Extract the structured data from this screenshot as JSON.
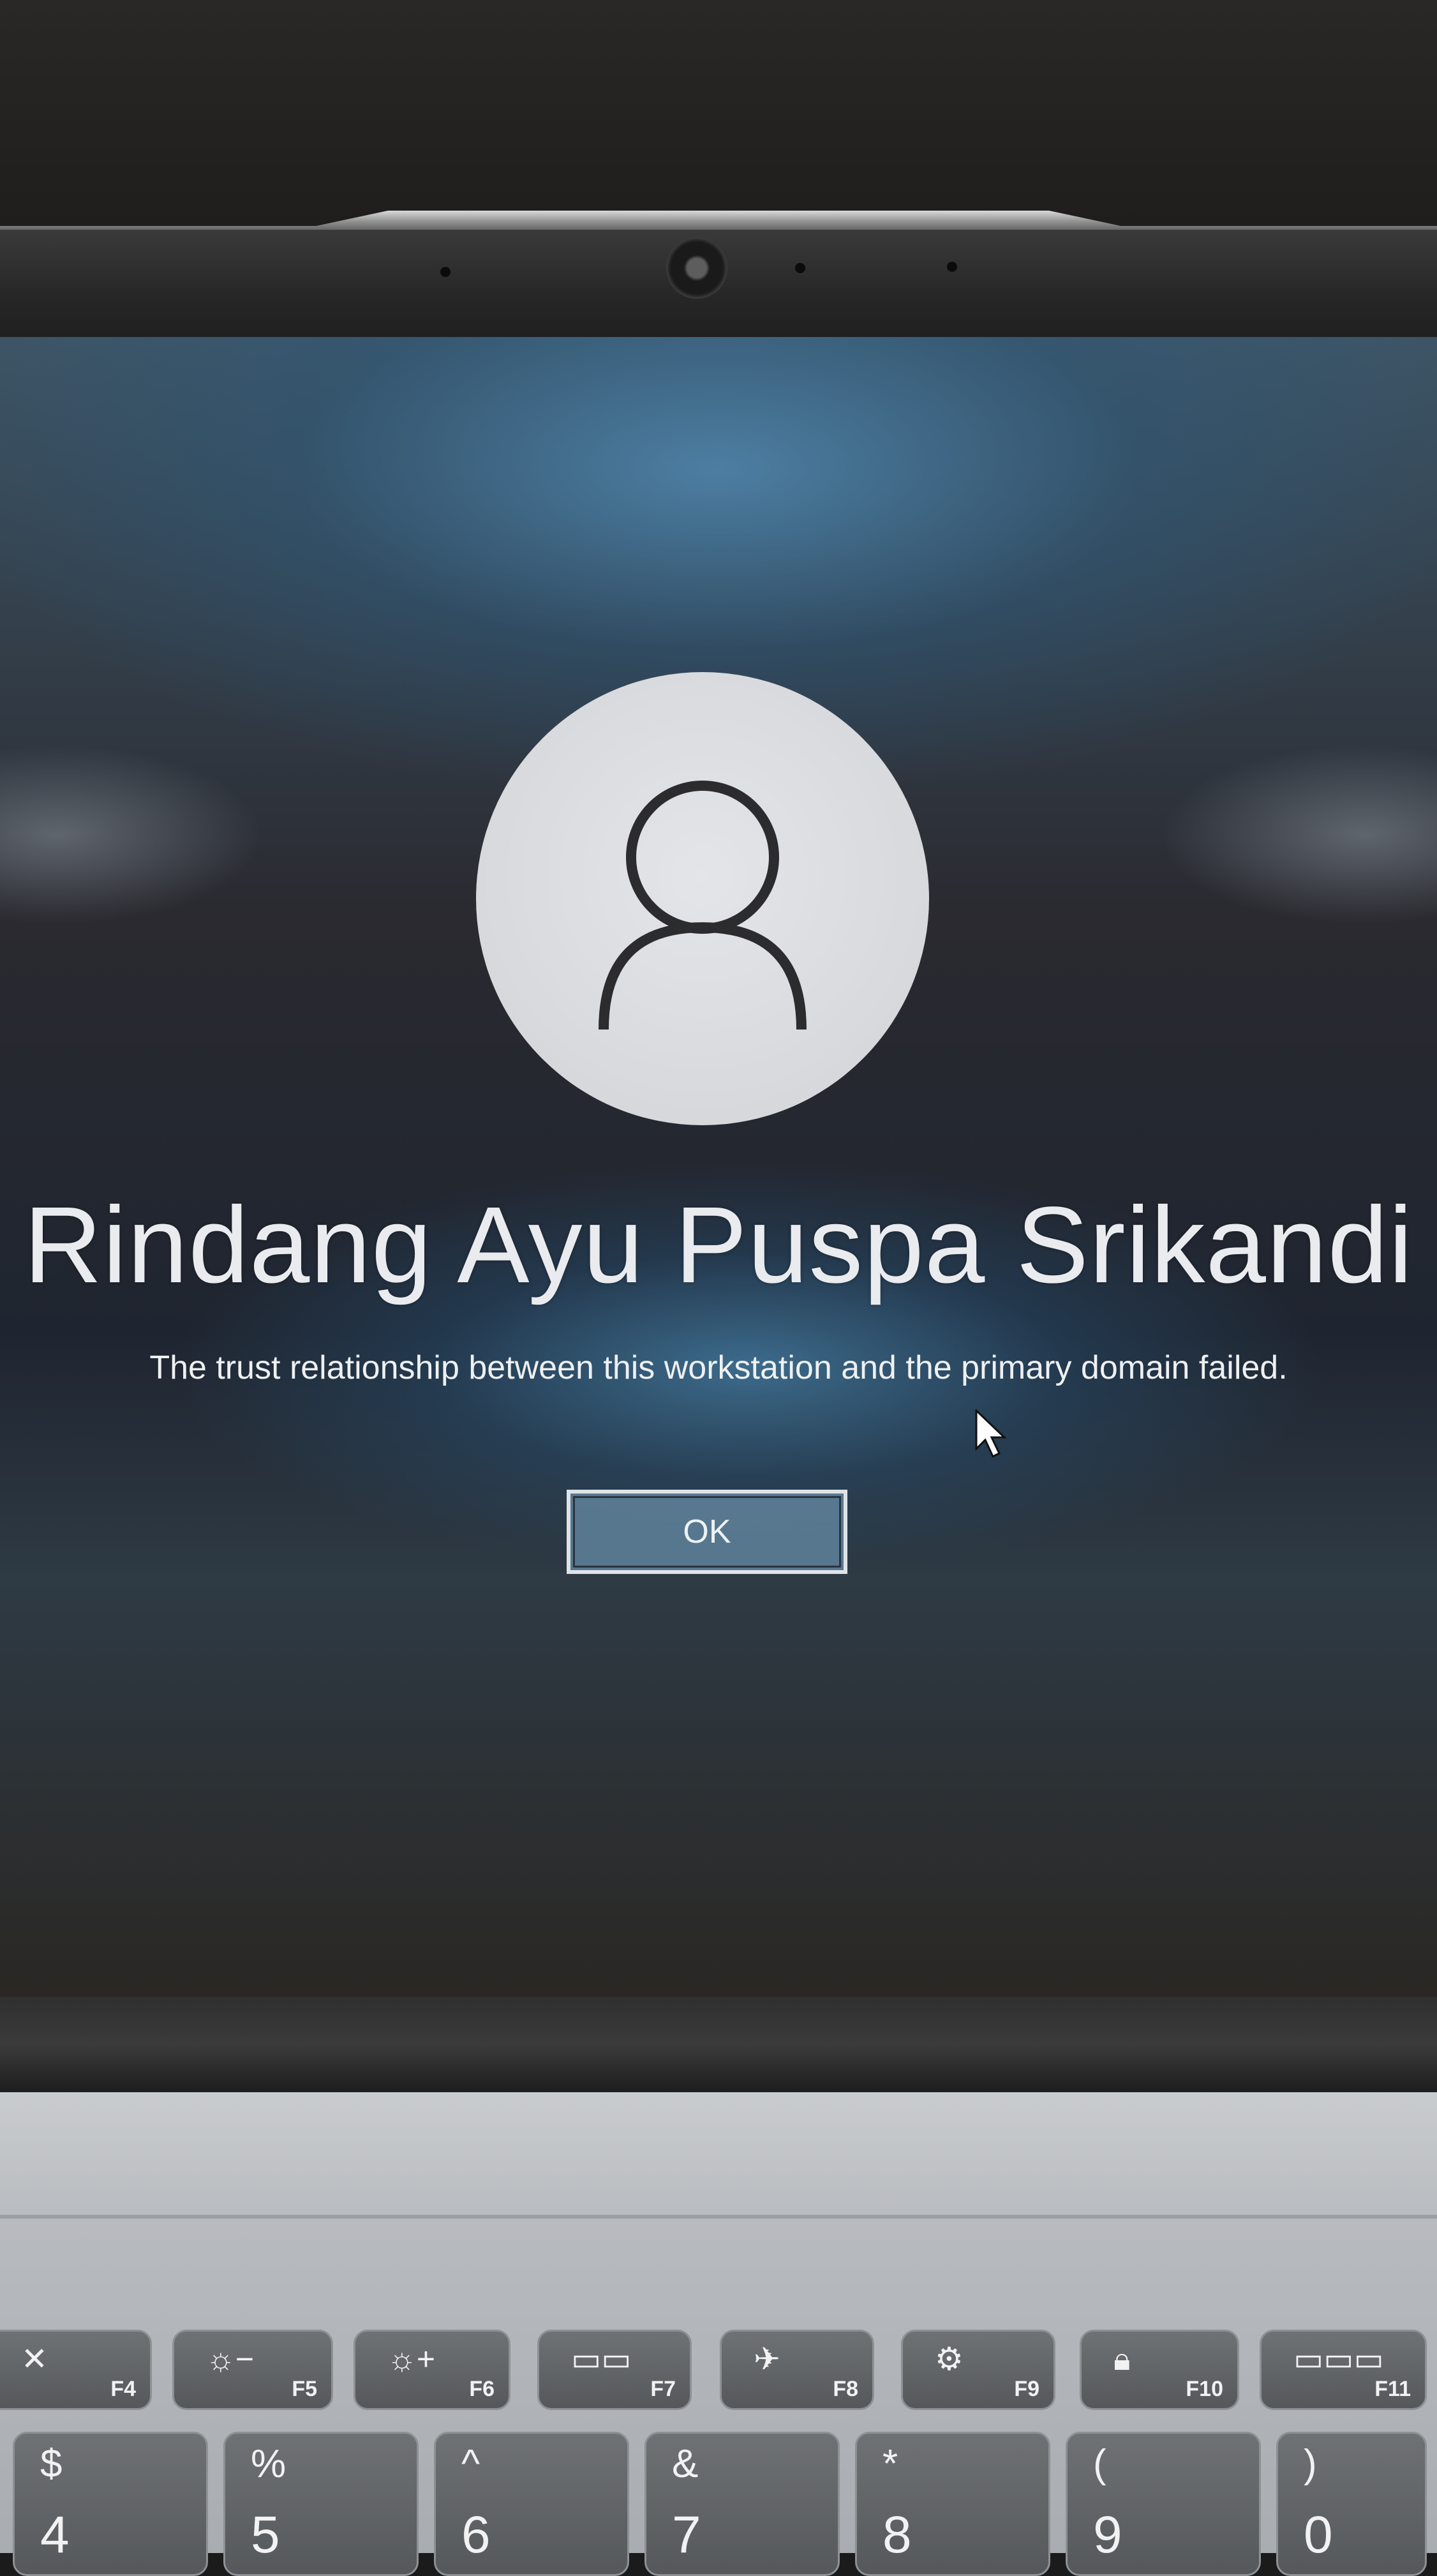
{
  "lock_screen": {
    "user_name": "Rindang Ayu Puspa Srikandi",
    "message": "The trust relationship between this workstation and the primary domain failed.",
    "ok_label": "OK",
    "avatar_icon": "person-icon",
    "accent_color": "#5f829b"
  },
  "keyboard": {
    "function_keys": [
      {
        "label": "F4",
        "icon": "mic-mute-icon"
      },
      {
        "label": "F5",
        "icon": "brightness-down-icon"
      },
      {
        "label": "F6",
        "icon": "brightness-up-icon"
      },
      {
        "label": "F7",
        "icon": "display-switch-icon"
      },
      {
        "label": "F8",
        "icon": "airplane-icon"
      },
      {
        "label": "F9",
        "icon": "settings-icon"
      },
      {
        "label": "F10",
        "icon": "lock-icon"
      },
      {
        "label": "F11",
        "icon": "window-icon"
      }
    ],
    "number_keys": [
      {
        "shift": "$",
        "main": "4"
      },
      {
        "shift": "%",
        "main": "5"
      },
      {
        "shift": "^",
        "main": "6"
      },
      {
        "shift": "&",
        "main": "7"
      },
      {
        "shift": "*",
        "main": "8"
      },
      {
        "shift": "(",
        "main": "9"
      },
      {
        "shift": ")",
        "main": "0"
      }
    ]
  }
}
